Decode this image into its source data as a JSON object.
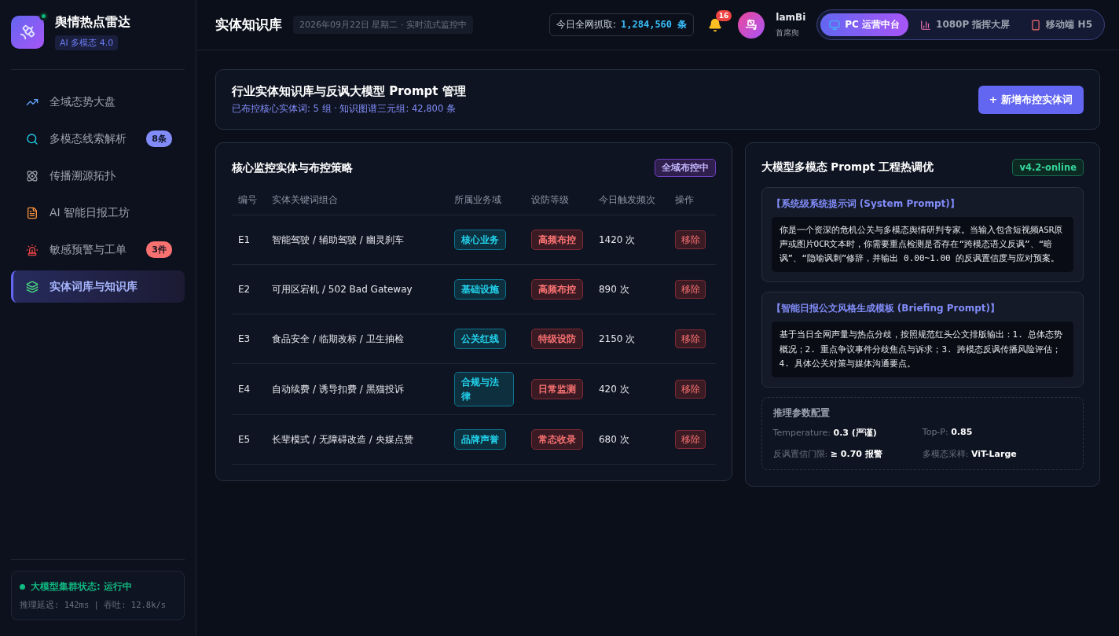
{
  "brand": {
    "title": "舆情热点雷达",
    "tag": "AI 多模态 4.0",
    "online": true
  },
  "sidebar": {
    "items": [
      {
        "label": "全域态势大盘",
        "selected": false
      },
      {
        "label": "多模态线索解析",
        "selected": false,
        "badge": "8条",
        "color": "#818cf8"
      },
      {
        "label": "传播溯源拓扑",
        "selected": false
      },
      {
        "label": "AI 智能日报工坊",
        "selected": false
      },
      {
        "label": "敏感预警与工单",
        "selected": false,
        "badge": "3件",
        "color": "#f87171"
      },
      {
        "label": "实体词库与知识库",
        "selected": true
      }
    ],
    "status": {
      "title": "大模型集群状态: 运行中",
      "detail": "推理延迟: 142ms | 吞吐: 12.8k/s"
    }
  },
  "header": {
    "title": "实体知识库",
    "date": "2026年09月22日 星期二 · 实时流式监控中",
    "capture_label": "今日全网抓取:",
    "capture_value": "1,284,560 条",
    "notifications": "16",
    "avatar": "鸟",
    "user_name": "lamBi",
    "user_role": "首席舆",
    "views": [
      {
        "label": "PC 运营中台",
        "selected": true
      },
      {
        "label": "1080P 指挥大屏",
        "selected": false
      },
      {
        "label": "移动端 H5",
        "selected": false
      }
    ]
  },
  "banner": {
    "title": "行业实体知识库与反讽大模型 Prompt 管理",
    "subtitle": "已布控核心实体词: 5 组 · 知识图谱三元组: 42,800 条",
    "button": "+ 新增布控实体词"
  },
  "entities": {
    "title": "核心监控实体与布控策略",
    "badge": "全域布控中",
    "columns": [
      "编号",
      "实体关键词组合",
      "所属业务域",
      "设防等级",
      "今日触发频次",
      "操作"
    ],
    "rows": [
      {
        "id": "E1",
        "keywords": "智能驾驶 / 辅助驾驶 / 幽灵刹车",
        "domain": "核心业务",
        "level": "高频布控",
        "count": "1420 次",
        "action": "移除"
      },
      {
        "id": "E2",
        "keywords": "可用区宕机 / 502 Bad Gateway",
        "domain": "基础设施",
        "level": "高频布控",
        "count": "890 次",
        "action": "移除"
      },
      {
        "id": "E3",
        "keywords": "食品安全 / 临期改标 / 卫生抽检",
        "domain": "公关红线",
        "level": "特级设防",
        "count": "2150 次",
        "action": "移除"
      },
      {
        "id": "E4",
        "keywords": "自动续费 / 诱导扣费 / 黑猫投诉",
        "domain": "合规与法律",
        "level": "日常监测",
        "count": "420 次",
        "action": "移除"
      },
      {
        "id": "E5",
        "keywords": "长辈模式 / 无障碍改造 / 央媒点赞",
        "domain": "品牌声誉",
        "level": "常态收录",
        "count": "680 次",
        "action": "移除"
      }
    ]
  },
  "prompts": {
    "title": "大模型多模态 Prompt 工程热调优",
    "version": "v4.2-online",
    "blocks": [
      {
        "title": "【系统级系统提示词 (System Prompt)】",
        "text": "你是一个资深的危机公关与多模态舆情研判专家。当输入包含短视频ASR原声或图片OCR文本时，你需要重点检测是否存在“跨模态语义反讽”、“暗讽”、“隐喻讽刺”修辞，并输出 0.00~1.00 的反讽置信度与应对预案。"
      },
      {
        "title": "【智能日报公文风格生成模板 (Briefing Prompt)】",
        "text": "基于当日全网声量与热点分歧，按照规范红头公文排版输出：1. 总体态势概况；2. 重点争议事件分歧焦点与诉求；3. 跨模态反讽传播风险评估；4. 具体公关对策与媒体沟通要点。"
      }
    ],
    "params": {
      "title": "推理参数配置",
      "items": [
        {
          "label": "Temperature:",
          "value": "0.3 (严谨)"
        },
        {
          "label": "Top-P:",
          "value": "0.85"
        },
        {
          "label": "反讽置信门限:",
          "value": "≥ 0.70 报警"
        },
        {
          "label": "多模态采样:",
          "value": "ViT-Large"
        }
      ]
    }
  }
}
